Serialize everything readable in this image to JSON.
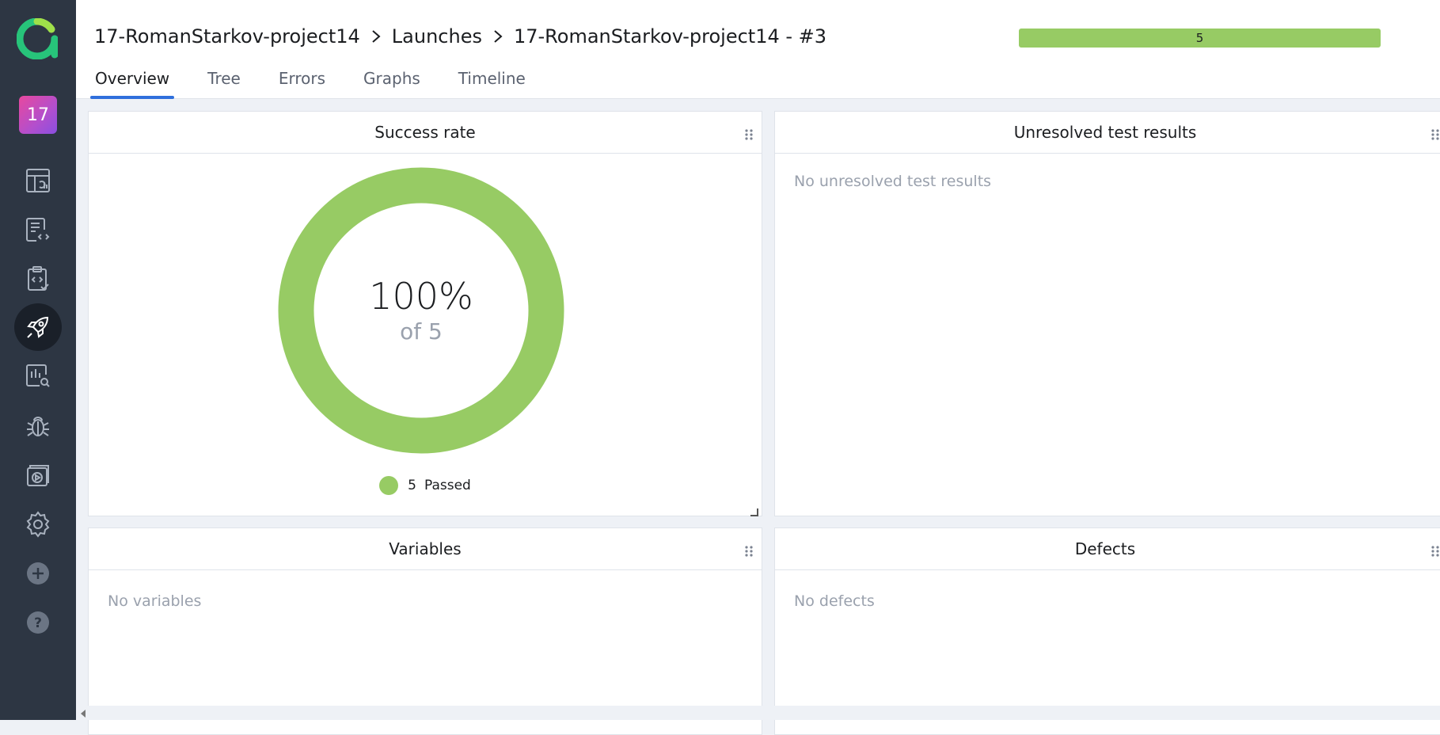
{
  "breadcrumb": {
    "project": "17-RomanStarkov-project14",
    "section": "Launches",
    "launch": "17-RomanStarkov-project14 - #3"
  },
  "progress": {
    "label": "5",
    "fraction": 1.0,
    "color": "#97cb64"
  },
  "sidebar": {
    "project_badge": "17",
    "items": [
      {
        "icon": "dashboard-icon"
      },
      {
        "icon": "test-cases-icon"
      },
      {
        "icon": "test-plans-icon"
      },
      {
        "icon": "launches-rocket-icon",
        "active": true
      },
      {
        "icon": "analytics-icon"
      },
      {
        "icon": "defects-bug-icon"
      },
      {
        "icon": "jobs-icon"
      },
      {
        "icon": "settings-gear-icon"
      },
      {
        "icon": "add-icon"
      },
      {
        "icon": "help-icon"
      }
    ]
  },
  "tabs": [
    {
      "label": "Overview",
      "active": true
    },
    {
      "label": "Tree"
    },
    {
      "label": "Errors"
    },
    {
      "label": "Graphs"
    },
    {
      "label": "Timeline"
    }
  ],
  "widgets": {
    "success_rate": {
      "title": "Success rate",
      "percent": "100%",
      "of_label": "of 5",
      "legend_count": "5",
      "legend_label": "Passed",
      "passed_fraction": 1.0,
      "color": "#97cb64"
    },
    "unresolved": {
      "title": "Unresolved test results",
      "empty": "No unresolved test results"
    },
    "variables": {
      "title": "Variables",
      "empty": "No variables"
    },
    "defects": {
      "title": "Defects",
      "empty": "No defects"
    }
  }
}
